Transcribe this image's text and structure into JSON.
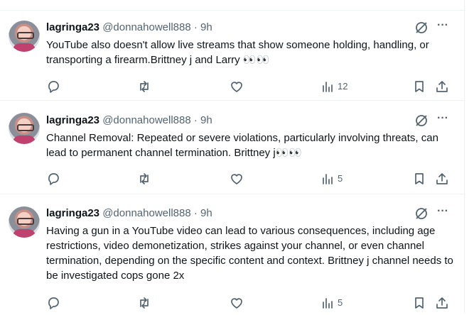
{
  "posts": [
    {
      "display_name": "lagringa23",
      "handle": "@donnahowell888",
      "separator": "·",
      "time": "9h",
      "text": "YouTube also doesn't allow live streams that show someone holding, handling, or transporting a firearm.Brittney j and Larry 👀👀",
      "views": "12"
    },
    {
      "display_name": "lagringa23",
      "handle": "@donnahowell888",
      "separator": "·",
      "time": "9h",
      "text": "Channel Removal: Repeated or severe violations, particularly involving threats, can lead to permanent channel termination. Brittney j👀👀",
      "views": "5"
    },
    {
      "display_name": "lagringa23",
      "handle": "@donnahowell888",
      "separator": "·",
      "time": "9h",
      "text": "Having a gun in a YouTube video can lead to various consequences, including age restrictions, video demonetization, strikes against your channel, or even channel termination, depending on the specific content and context. Brittney j channel needs to be investigated cops gone 2x",
      "views": "5"
    }
  ],
  "icons": {
    "reply": "reply-icon",
    "repost": "repost-icon",
    "like": "like-icon",
    "views": "views-icon",
    "bookmark": "bookmark-icon",
    "share": "share-icon",
    "grok": "grok-icon",
    "more": "more-icon"
  },
  "colors": {
    "text": "#0f1419",
    "secondary": "#536471",
    "divider": "#eff3f4"
  }
}
